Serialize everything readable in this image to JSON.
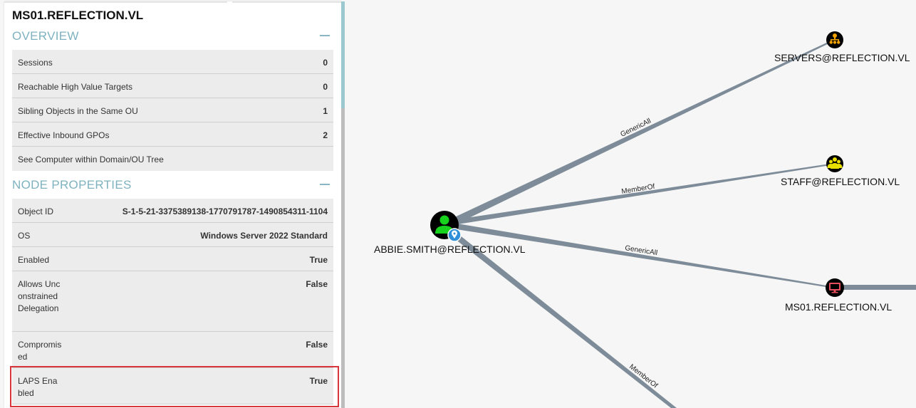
{
  "panel": {
    "title": "MS01.REFLECTION.VL",
    "overview": {
      "heading": "OVERVIEW",
      "rows": [
        {
          "label": "Sessions",
          "value": "0"
        },
        {
          "label": "Reachable High Value Targets",
          "value": "0"
        },
        {
          "label": "Sibling Objects in the Same OU",
          "value": "1"
        },
        {
          "label": "Effective Inbound GPOs",
          "value": "2"
        },
        {
          "label": "See Computer within Domain/OU Tree",
          "value": ""
        }
      ]
    },
    "properties": {
      "heading": "NODE PROPERTIES",
      "rows": [
        {
          "label": "Object ID",
          "value": "S-1-5-21-3375389138-1770791787-1490854311-1104"
        },
        {
          "label": "OS",
          "value": "Windows Server 2022 Standard"
        },
        {
          "label": "Enabled",
          "value": "True"
        },
        {
          "label": "Allows Unconstrained Delegation",
          "value": "False"
        },
        {
          "label": "Compromised",
          "value": "False"
        },
        {
          "label": "LAPS Enabled",
          "value": "True"
        }
      ]
    }
  },
  "graph": {
    "nodes": [
      {
        "label": "ABBIE.SMITH@REFLECTION.VL",
        "icon": "user-icon",
        "color": "#17d31e"
      },
      {
        "label": "SERVERS@REFLECTION.VL",
        "icon": "group-icon",
        "color": "#f0a000"
      },
      {
        "label": "STAFF@REFLECTION.VL",
        "icon": "group-icon",
        "color": "#e8e000"
      },
      {
        "label": "MS01.REFLECTION.VL",
        "icon": "computer-icon",
        "color": "#e74c5c"
      }
    ],
    "edges": [
      {
        "label": "GenericAll",
        "from": "ABBIE.SMITH@REFLECTION.VL",
        "to": "SERVERS@REFLECTION.VL"
      },
      {
        "label": "MemberOf",
        "from": "ABBIE.SMITH@REFLECTION.VL",
        "to": "STAFF@REFLECTION.VL"
      },
      {
        "label": "GenericAll",
        "from": "ABBIE.SMITH@REFLECTION.VL",
        "to": "MS01.REFLECTION.VL"
      },
      {
        "label": "MemberOf",
        "from": "ABBIE.SMITH@REFLECTION.VL",
        "to": ""
      }
    ],
    "colors": {
      "edge": "#7d8c98",
      "owned_badge": "#2f8fd8"
    }
  }
}
